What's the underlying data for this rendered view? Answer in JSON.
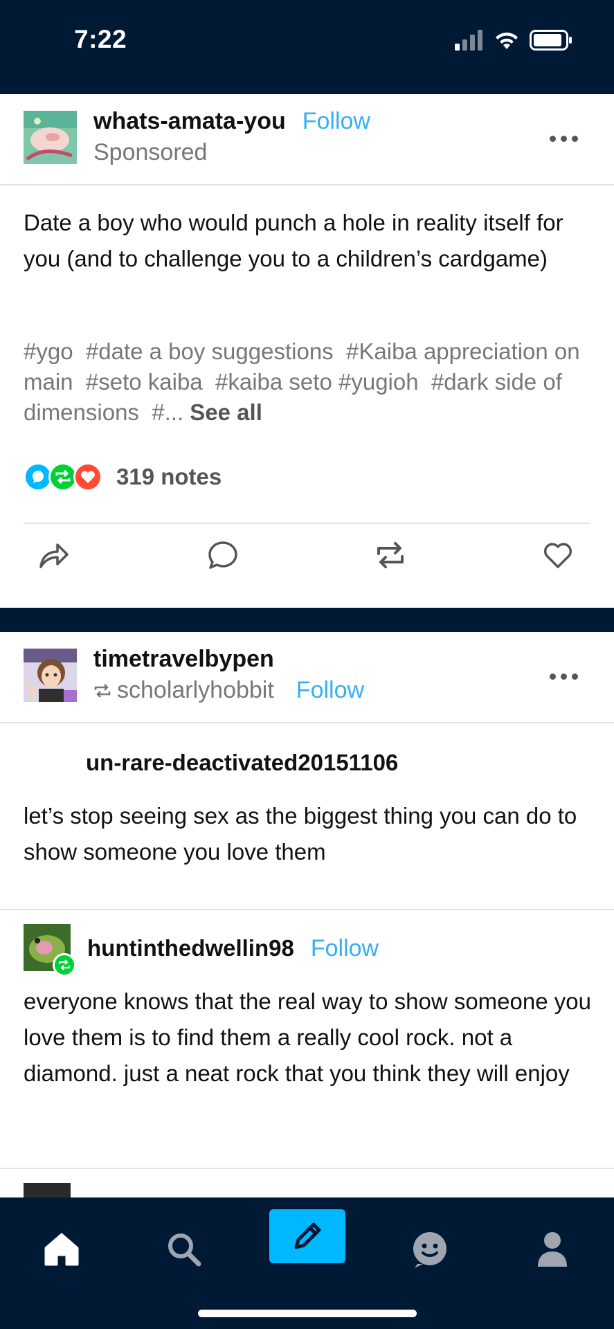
{
  "status_bar": {
    "time": "7:22"
  },
  "posts": [
    {
      "blog_name": "whats-amata-you",
      "follow_label": "Follow",
      "sponsored_label": "Sponsored",
      "body": "Date a boy who would punch a hole in reality itself for you (and to challenge you to a children’s cardgame)",
      "tags": [
        "#ygo",
        "#date a boy suggestions",
        "#Kaiba appreciation on main",
        "#seto kaiba",
        "#kaiba seto",
        "#yugioh",
        "#dark side of dimensions",
        "#..."
      ],
      "see_all_label": "See all",
      "notes": "319 notes",
      "note_badge_colors": {
        "reply": "#00b8ff",
        "reblog": "#00cf35",
        "like": "#ff4930"
      }
    },
    {
      "blog_name": "timetravelbypen",
      "reblogged_from": "scholarlyhobbit",
      "follow_label": "Follow",
      "original_author": "un-rare-deactivated20151106",
      "original_text": "let’s stop seeing sex as the biggest thing you can do to show someone you love them",
      "trail": [
        {
          "name": "huntinthedwellin98",
          "follow_label": "Follow",
          "text": "everyone knows that the real way to show someone you love them is to find them a really cool rock. not a diamond. just a neat rock that you think they will enjoy"
        }
      ]
    }
  ],
  "tab_bar": {
    "items": [
      "home-icon",
      "search-icon",
      "compose-icon",
      "activity-icon",
      "account-icon"
    ],
    "accent_color": "#00b8ff"
  }
}
